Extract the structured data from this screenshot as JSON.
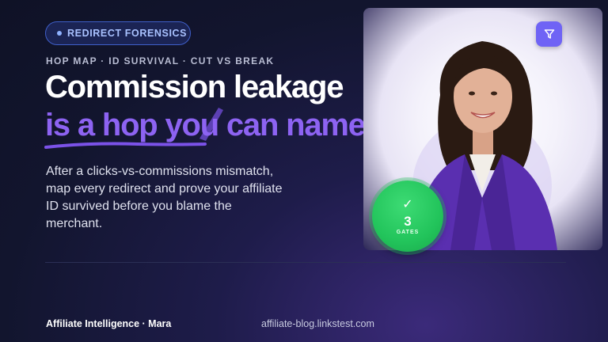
{
  "badge_top": {
    "label": "REDIRECT FORENSICS"
  },
  "kicker": "HOP MAP · ID SURVIVAL · CUT VS BREAK",
  "headline": {
    "line1": "Commission leakage",
    "line2": "is a hop you can name"
  },
  "body_text": "After a clicks-vs-commissions mismatch, map every redirect and prove your affiliate ID survived before you blame the merchant.",
  "stat_badge": {
    "value": "3",
    "unit": "GATES"
  },
  "footer": {
    "left": "Affiliate Intelligence · Mara",
    "right": "affiliate-blog.linkstest.com"
  },
  "colors": {
    "accent_purple": "#8d63f2",
    "pill_text": "#a9c2ff",
    "badge_green": "#22c45b",
    "filter_button": "#6f63f5"
  },
  "icons": [
    "filter-icon",
    "check-icon"
  ]
}
